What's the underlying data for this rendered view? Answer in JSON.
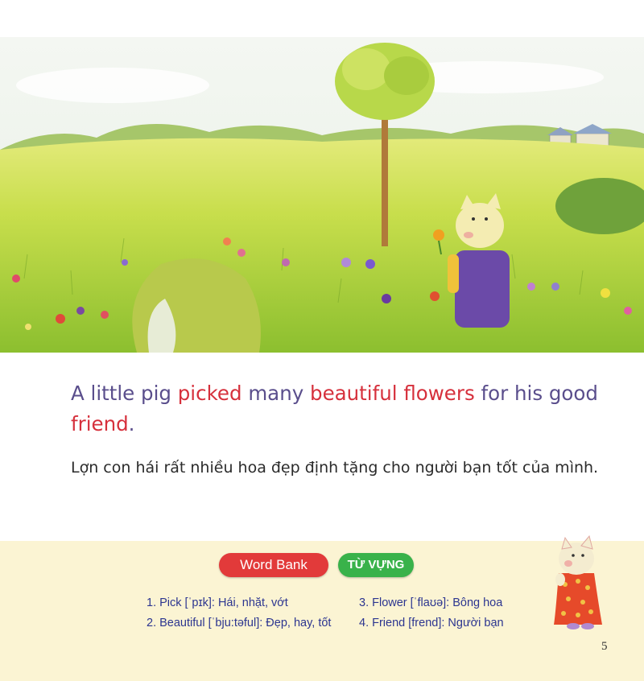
{
  "story": {
    "en": [
      {
        "text": "A little pig ",
        "hl": false
      },
      {
        "text": "picked",
        "hl": true
      },
      {
        "text": " many ",
        "hl": false
      },
      {
        "text": "beautiful flowers",
        "hl": true
      },
      {
        "text": " for his good ",
        "hl": false
      },
      {
        "text": "friend",
        "hl": true
      },
      {
        "text": ".",
        "hl": false
      }
    ],
    "vi": "Lợn con hái rất nhiều hoa đẹp định tặng cho người bạn tốt của mình."
  },
  "word_bank": {
    "label": "Word Bank",
    "label_vi": "TỪ VỰNG",
    "items": [
      "1. Pick [ˈpɪk]: Hái, nhặt, vớt",
      "2. Beautiful [ˈbju:təful]: Đẹp, hay, tốt",
      "3. Flower [ˈflaʊə]: Bông hoa",
      "4. Friend [frend]: Người bạn"
    ]
  },
  "page_number": "5",
  "colors": {
    "english_text": "#5a4e8c",
    "highlight": "#d6303c",
    "word_bank_pill": "#e23a3a",
    "tu_vung_pill": "#39b24a",
    "vocab_text": "#2c3590",
    "band": "#fbf4d3"
  }
}
